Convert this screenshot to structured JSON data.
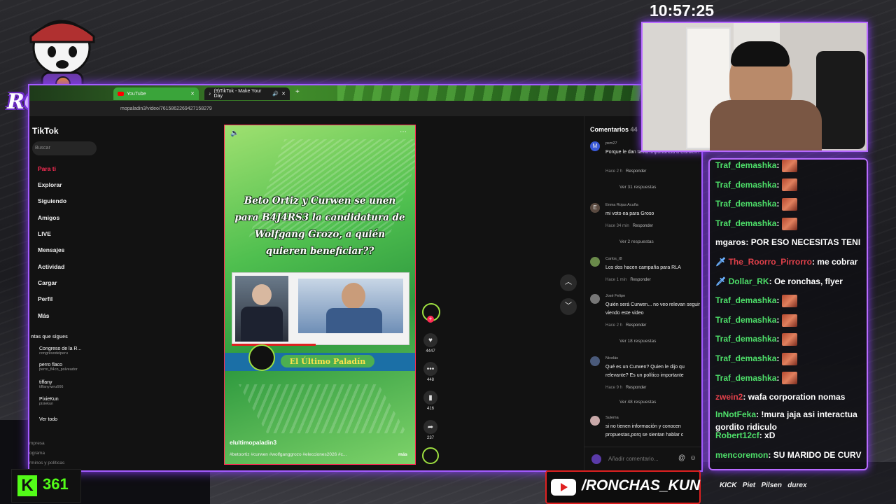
{
  "overlay": {
    "clock": "10:57:25",
    "logo_text": "RONCHAS",
    "kick_count": "361",
    "youtube_handle": "/RONCHAS_KUN",
    "sponsors": [
      "KICK",
      "Piet",
      "Pilsen",
      "durex"
    ]
  },
  "browser": {
    "tabs": [
      {
        "label": "YouTube"
      },
      {
        "label": "(9)TikTok - Make Your Day"
      }
    ],
    "url": "mopaladin3/video/7615862269427158279"
  },
  "sidebar": {
    "brand": "TikTok",
    "search_placeholder": "Buscar",
    "nav": [
      "Para ti",
      "Explorar",
      "Siguiendo",
      "Amigos",
      "LIVE",
      "Mensajes",
      "Actividad",
      "Cargar",
      "Perfil",
      "Más"
    ],
    "following_header": "ntas que sigues",
    "following": [
      {
        "name": "Congreso de la R...",
        "handle": "congresodelperu"
      },
      {
        "name": "perro flaco",
        "handle": "perro_fl4co_polveadоr"
      },
      {
        "name": "tiffany",
        "handle": "tiffanyrwru666"
      },
      {
        "name": "PixieKun",
        "handle": "pixiekun"
      }
    ],
    "see_all": "Ver todo",
    "footer": [
      "mpresa",
      "ograma",
      "rminos y políticas"
    ]
  },
  "video": {
    "headline": "Beto Ortiz y Curwen se unen para B4J4RS3 la candidatura de Wolfgang Grozo, a quién quieren beneficiar??",
    "banner": "El Último Paladín",
    "author": "elultimopaladin3",
    "hashtags": "#betoortiz #curwen #wolfganggrozo #elecciones2026 #c...",
    "more": "más"
  },
  "actions": {
    "likes": "4447",
    "comments": "448",
    "saves": "416",
    "shares": "237"
  },
  "comments": {
    "header": "Comentarios",
    "count": "44",
    "input_placeholder": "Añadir comentario...",
    "items": [
      {
        "user": "psm27",
        "initial": "M",
        "text": "Porque le dan tanta importancia a Curwen?",
        "time": "Hace 2 h",
        "reply": "Responder",
        "more": "Ver 31 respuestas"
      },
      {
        "user": "Enma Rojas Acuña",
        "initial": "E",
        "text": "mi voto ea para Groso",
        "time": "Hace 34 min",
        "reply": "Responder",
        "more": "Ver 2 respuestas"
      },
      {
        "user": "Carlos_t8",
        "initial": "",
        "text": "Los dos hacen campaña para RLA",
        "time": "Hace 1 min",
        "reply": "Responder",
        "more": ""
      },
      {
        "user": "José Felipe",
        "initial": "",
        "text": "Quién será Curwen... no veo relevan seguir viendo este video",
        "time": "Hace 2 h",
        "reply": "Responder",
        "more": "Ver 18 respuestas"
      },
      {
        "user": "Nicolás",
        "initial": "",
        "text": "Qué es un Curwen? Quien le dijo qu relevante? Es un político importante",
        "time": "Hace 9 h",
        "reply": "Responder",
        "more": "Ver 48 respuestas"
      },
      {
        "user": "Sulema",
        "initial": "",
        "text": "si no tienen información y conocen propuestas,porq se sientan hablar c",
        "time": "",
        "reply": "",
        "more": ""
      }
    ]
  },
  "chat": [
    {
      "user": "Traf_demashka",
      "color": "#4ee06a",
      "text": "",
      "emote": true,
      "badge": ""
    },
    {
      "user": "Traf_demashka",
      "color": "#4ee06a",
      "text": "",
      "emote": true,
      "badge": ""
    },
    {
      "user": "Traf_demashka",
      "color": "#4ee06a",
      "text": "",
      "emote": true,
      "badge": ""
    },
    {
      "user": "Traf_demashka",
      "color": "#4ee06a",
      "text": "",
      "emote": true,
      "badge": ""
    },
    {
      "user": "mgaros",
      "color": "#ffffff",
      "text": "POR ESO NECESITAS TENI",
      "emote": false,
      "badge": ""
    },
    {
      "user": "The_Roorro_Pirrorro",
      "color": "#e0404a",
      "text": "me cobrar",
      "emote": false,
      "badge": "sword"
    },
    {
      "user": "Dollar_RK",
      "color": "#4ee06a",
      "text": "Oe ronchas, flyer",
      "emote": false,
      "badge": "sword"
    },
    {
      "user": "Traf_demashka",
      "color": "#4ee06a",
      "text": "",
      "emote": true,
      "badge": ""
    },
    {
      "user": "Traf_demashka",
      "color": "#4ee06a",
      "text": "",
      "emote": true,
      "badge": ""
    },
    {
      "user": "Traf_demashka",
      "color": "#4ee06a",
      "text": "",
      "emote": true,
      "badge": ""
    },
    {
      "user": "Traf_demashka",
      "color": "#4ee06a",
      "text": "",
      "emote": true,
      "badge": ""
    },
    {
      "user": "Traf_demashka",
      "color": "#4ee06a",
      "text": "",
      "emote": true,
      "badge": ""
    },
    {
      "user": "zwein2",
      "color": "#e0404a",
      "text": "wafa corporation nomas",
      "emote": false,
      "badge": ""
    },
    {
      "user": "InNotFeka",
      "color": "#4ee06a",
      "text": "!mura jaja asi interactua gordito ridiculo",
      "emote": false,
      "badge": ""
    },
    {
      "user": "Robert12cf",
      "color": "#4ee06a",
      "text": "xD",
      "emote": false,
      "badge": ""
    },
    {
      "user": "mencoremon",
      "color": "#4ee06a",
      "text": "SU MARIDO DE CURV",
      "emote": false,
      "badge": ""
    }
  ],
  "colors": {
    "accent": "#b86bff",
    "tiktok_red": "#ff2c55",
    "chat_green": "#4ee06a",
    "youtube_red": "#e02020"
  }
}
